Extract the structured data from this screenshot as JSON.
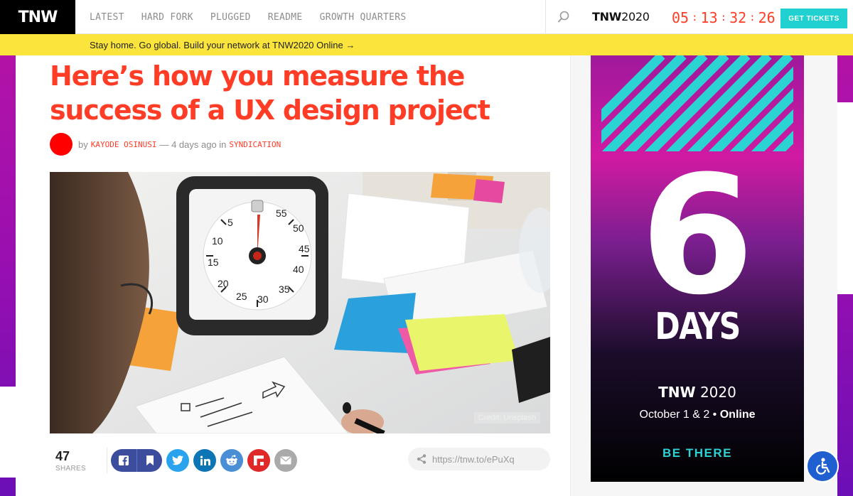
{
  "nav": {
    "logo": "TNW",
    "links": [
      "LATEST",
      "HARD FORK",
      "PLUGGED",
      "README",
      "GROWTH QUARTERS"
    ],
    "event_logo": "TNW",
    "event_year": "2020",
    "countdown": [
      "05",
      "13",
      "32",
      "26"
    ],
    "countdown_sep": ":",
    "tickets_label": "GET TICKETS",
    "icons": {
      "search": "search-icon"
    }
  },
  "promo": {
    "text": "Stay home. Go global. Build your network at TNW2020 Online →"
  },
  "article": {
    "headline": "Here’s how you measure the success of a UX design project",
    "byline_prefix": "by",
    "author": "KAYODE OSINUSI",
    "byline_mid": "— 4 days ago in",
    "category": "SYNDICATION",
    "image_credit": "Credit: Unsplash"
  },
  "share": {
    "count": "47",
    "count_label": "SHARES",
    "buttons": [
      "facebook",
      "bookmark",
      "twitter",
      "linkedin",
      "reddit",
      "flipboard",
      "email"
    ],
    "short_url": "https://tnw.to/ePuXq"
  },
  "ad": {
    "number": "6",
    "unit": "DAYS",
    "brand": "TNW",
    "year": "2020",
    "date": "October 1 & 2",
    "mode": "Online",
    "cta": "BE THERE"
  },
  "colors": {
    "accent": "#ff3c26",
    "promo": "#fbe43c",
    "ticket": "#21d1d1",
    "facebook": "#3d4d9e",
    "twitter": "#2aa3ef",
    "linkedin": "#0c75b3",
    "reddit": "#4a8fd6",
    "flipboard": "#e12828",
    "email": "#aaaaaa"
  }
}
